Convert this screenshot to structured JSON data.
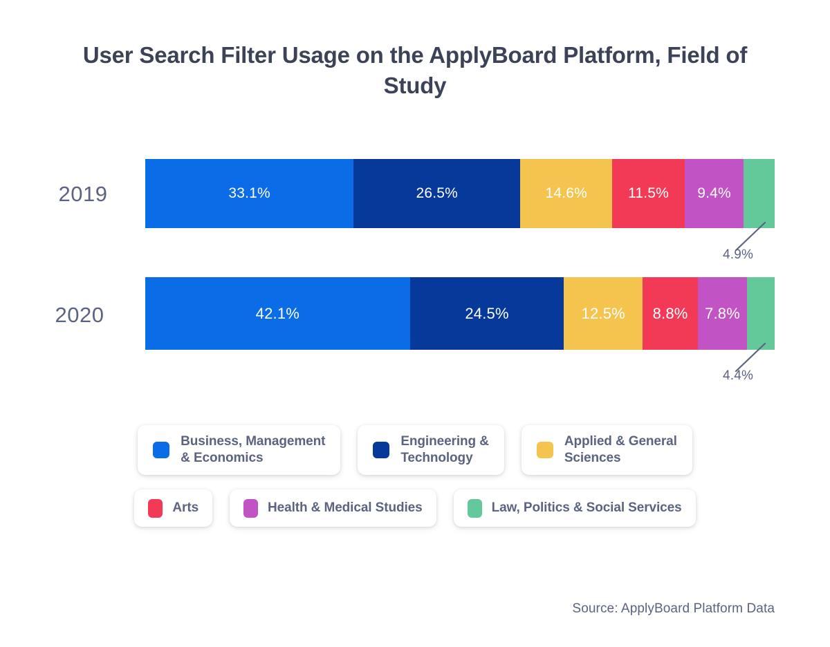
{
  "title": "User Search Filter Usage on the ApplyBoard Platform,\nField of Study",
  "source": "Source: ApplyBoard Platform Data",
  "colors": {
    "business": "#0a6ce6",
    "engineering": "#06399a",
    "applied": "#f5c44e",
    "arts": "#f23a56",
    "health": "#c253c4",
    "law": "#63c99b",
    "title_text": "#3c4257",
    "label_text": "#5c6380",
    "bar_text": "#ffffff",
    "background": "#ffffff"
  },
  "chart_data": {
    "type": "bar",
    "subtype": "stacked-horizontal-100",
    "title": "User Search Filter Usage on the ApplyBoard Platform, Field of Study",
    "xlabel": "",
    "ylabel": "",
    "xlim": [
      0,
      100
    ],
    "grid": false,
    "legend_position": "bottom",
    "categories": [
      "2019",
      "2020"
    ],
    "series": [
      {
        "name": "Business, Management & Economics",
        "color": "#0a6ce6",
        "values": [
          33.1,
          42.1
        ],
        "labels": [
          "33.1%",
          "42.1%"
        ]
      },
      {
        "name": "Engineering & Technology",
        "color": "#06399a",
        "values": [
          26.5,
          24.5
        ],
        "labels": [
          "26.5%",
          "24.5%"
        ]
      },
      {
        "name": "Applied & General Sciences",
        "color": "#f5c44e",
        "values": [
          14.6,
          12.5
        ],
        "labels": [
          "14.6%",
          "12.5%"
        ]
      },
      {
        "name": "Arts",
        "color": "#f23a56",
        "values": [
          11.5,
          8.8
        ],
        "labels": [
          "11.5%",
          "8.8%"
        ]
      },
      {
        "name": "Health & Medical Studies",
        "color": "#c253c4",
        "values": [
          9.4,
          7.8
        ],
        "labels": [
          "9.4%",
          "7.8%"
        ]
      },
      {
        "name": "Law, Politics & Social Services",
        "color": "#63c99b",
        "values": [
          4.9,
          4.4
        ],
        "labels": [
          "4.9%",
          "4.4%"
        ]
      }
    ],
    "callouts": [
      {
        "category": "2019",
        "series": "Law, Politics & Social Services",
        "label": "4.9%"
      },
      {
        "category": "2020",
        "series": "Law, Politics & Social Services",
        "label": "4.4%"
      }
    ]
  },
  "bars": [
    {
      "year": "2019",
      "segments": [
        {
          "key": "business",
          "label": "33.1%",
          "value": 33.1,
          "color": "#0a6ce6",
          "inside": true
        },
        {
          "key": "engineering",
          "label": "26.5%",
          "value": 26.5,
          "color": "#06399a",
          "inside": true
        },
        {
          "key": "applied",
          "label": "14.6%",
          "value": 14.6,
          "color": "#f5c44e",
          "inside": true
        },
        {
          "key": "arts",
          "label": "11.5%",
          "value": 11.5,
          "color": "#f23a56",
          "inside": true
        },
        {
          "key": "health",
          "label": "9.4%",
          "value": 9.4,
          "color": "#c253c4",
          "inside": true
        },
        {
          "key": "law",
          "label": "4.9%",
          "value": 4.9,
          "color": "#63c99b",
          "inside": false
        }
      ]
    },
    {
      "year": "2020",
      "segments": [
        {
          "key": "business",
          "label": "42.1%",
          "value": 42.1,
          "color": "#0a6ce6",
          "inside": true
        },
        {
          "key": "engineering",
          "label": "24.5%",
          "value": 24.5,
          "color": "#06399a",
          "inside": true
        },
        {
          "key": "applied",
          "label": "12.5%",
          "value": 12.5,
          "color": "#f5c44e",
          "inside": true
        },
        {
          "key": "arts",
          "label": "8.8%",
          "value": 8.8,
          "color": "#f23a56",
          "inside": true
        },
        {
          "key": "health",
          "label": "7.8%",
          "value": 7.8,
          "color": "#c253c4",
          "inside": true
        },
        {
          "key": "law",
          "label": "4.4%",
          "value": 4.4,
          "color": "#63c99b",
          "inside": false
        }
      ]
    }
  ],
  "callouts": {
    "y2019": "4.9%",
    "y2020": "4.4%"
  },
  "legend": {
    "row1": [
      {
        "label": "Business, Management\n& Economics",
        "color": "#0a6ce6",
        "key": "business"
      },
      {
        "label": "Engineering &\nTechnology",
        "color": "#06399a",
        "key": "engineering"
      },
      {
        "label": "Applied & General\nSciences",
        "color": "#f5c44e",
        "key": "applied"
      }
    ],
    "row2": [
      {
        "label": "Arts",
        "color": "#f23a56",
        "key": "arts"
      },
      {
        "label": "Health & Medical Studies",
        "color": "#c253c4",
        "key": "health"
      },
      {
        "label": "Law, Politics & Social Services",
        "color": "#63c99b",
        "key": "law"
      }
    ]
  }
}
